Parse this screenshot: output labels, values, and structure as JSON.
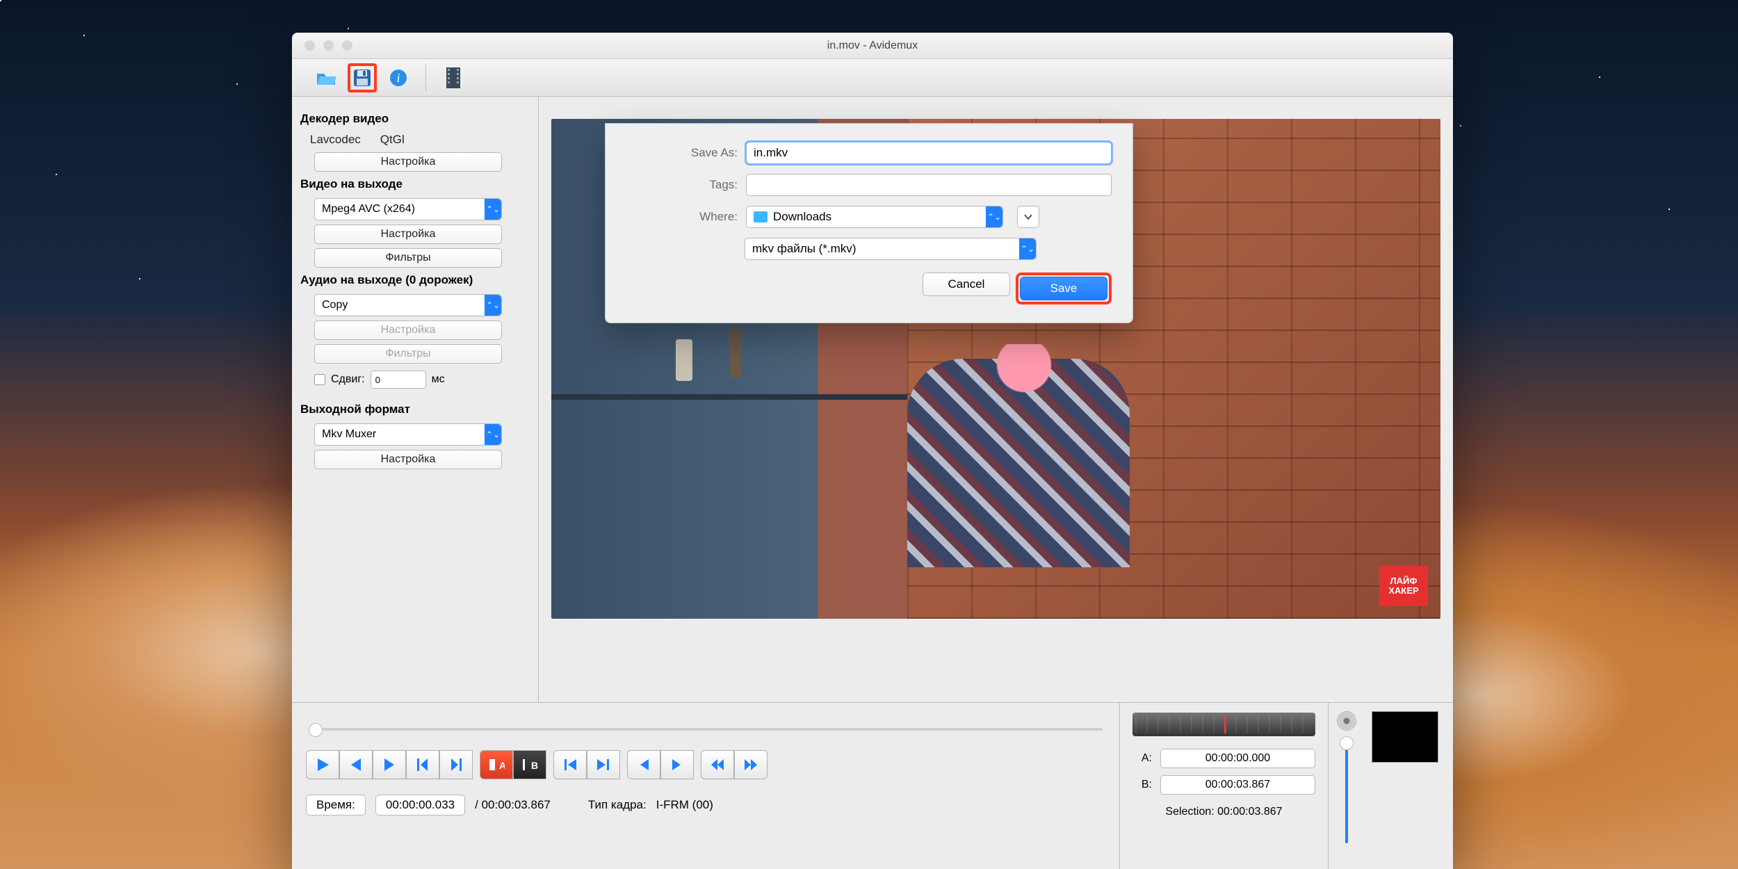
{
  "window": {
    "title": "in.mov - Avidemux"
  },
  "toolbar": {
    "open_icon": "open-folder-icon",
    "save_icon": "save-disk-icon",
    "info_icon": "info-icon",
    "film_icon": "film-strip-icon"
  },
  "sidebar": {
    "video_decoder": {
      "heading": "Декодер видео",
      "codec1": "Lavcodec",
      "codec2": "QtGl",
      "settings": "Настройка"
    },
    "video_output": {
      "heading": "Видео на выходе",
      "codec": "Mpeg4 AVC (x264)",
      "settings": "Настройка",
      "filters": "Фильтры"
    },
    "audio_output": {
      "heading": "Аудио на выходе (0 дорожек)",
      "mode": "Copy",
      "settings": "Настройка",
      "filters": "Фильтры",
      "shift_label": "Сдвиг:",
      "shift_value": "0",
      "shift_unit": "мс"
    },
    "output_format": {
      "heading": "Выходной формат",
      "muxer": "Mkv Muxer",
      "settings": "Настройка"
    }
  },
  "video_badge": "ЛАЙФ\nХАКЕР",
  "bottom": {
    "time_label": "Время:",
    "time_current": "00:00:00.033",
    "time_sep": "/ 00:00:03.867",
    "frame_type_label": "Тип кадра:",
    "frame_type_value": "I-FRM (00)",
    "a_label": "A:",
    "a_value": "00:00:00.000",
    "b_label": "B:",
    "b_value": "00:00:03.867",
    "selection_label": "Selection:",
    "selection_value": "00:00:03.867"
  },
  "dialog": {
    "save_as_label": "Save As:",
    "save_as_value": "in.mkv",
    "tags_label": "Tags:",
    "tags_value": "",
    "where_label": "Where:",
    "where_value": "Downloads",
    "filetype": "mkv файлы (*.mkv)",
    "cancel": "Cancel",
    "save": "Save"
  }
}
